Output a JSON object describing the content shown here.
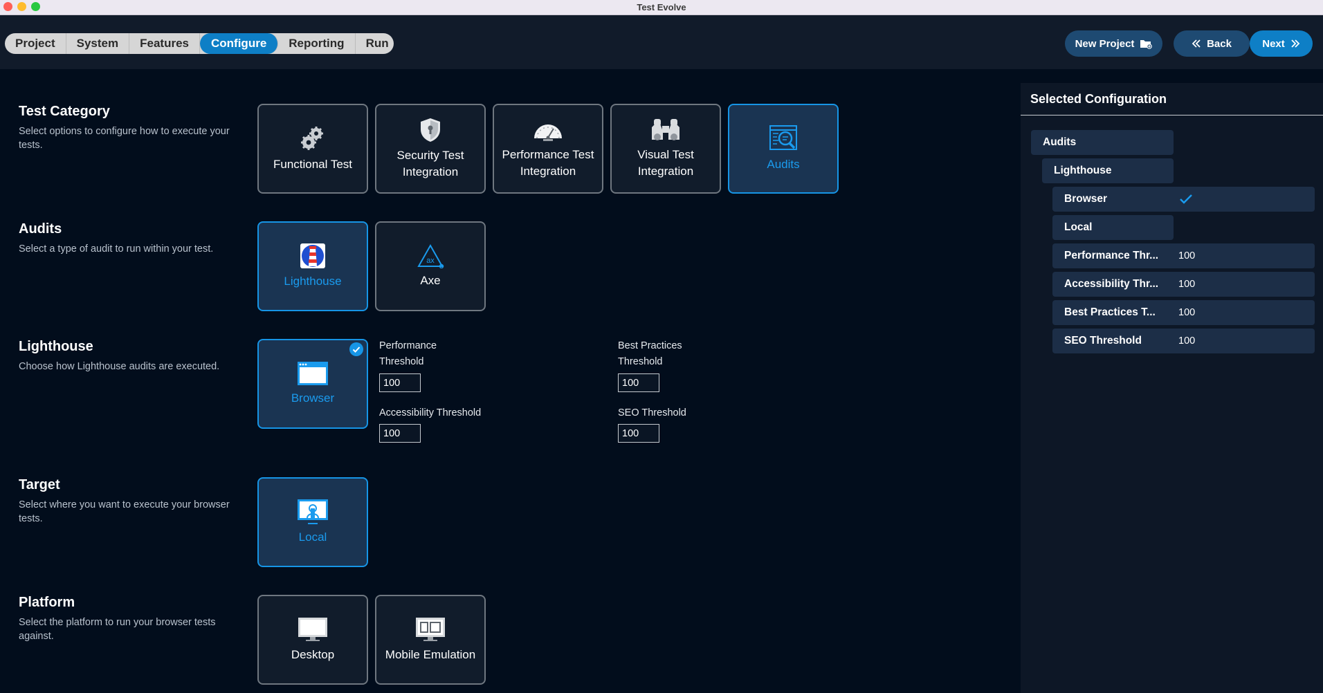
{
  "window": {
    "title": "Test Evolve"
  },
  "nav": {
    "tabs": [
      "Project",
      "System",
      "Features",
      "Configure",
      "Reporting",
      "Run"
    ],
    "active_tab": "Configure",
    "new_project_label": "New Project",
    "back_label": "Back",
    "next_label": "Next"
  },
  "sections": {
    "test_category": {
      "title": "Test Category",
      "desc": "Select options to configure how to execute your tests.",
      "options": [
        {
          "line1": "Functional Test",
          "line2": "",
          "icon": "gears-icon",
          "selected": false
        },
        {
          "line1": "Security Test",
          "line2": "Integration",
          "icon": "shield-icon",
          "selected": false
        },
        {
          "line1": "Performance Test",
          "line2": "Integration",
          "icon": "speedometer-icon",
          "selected": false
        },
        {
          "line1": "Visual Test",
          "line2": "Integration",
          "icon": "binoculars-icon",
          "selected": false
        },
        {
          "line1": "Audits",
          "line2": "",
          "icon": "audit-magnifier-icon",
          "selected": true
        }
      ]
    },
    "audits": {
      "title": "Audits",
      "desc": "Select a type of audit to run within your test.",
      "options": [
        {
          "label": "Lighthouse",
          "icon": "lighthouse-icon",
          "selected": true
        },
        {
          "label": "Axe",
          "icon": "axe-icon",
          "selected": false
        }
      ]
    },
    "lighthouse": {
      "title": "Lighthouse",
      "desc": "Choose how Lighthouse audits are executed.",
      "options": [
        {
          "label": "Browser",
          "icon": "browser-window-icon",
          "selected": true
        }
      ],
      "fields": {
        "performance": {
          "label_line1": "Performance",
          "label_line2": "Threshold",
          "value": "100"
        },
        "best_practices": {
          "label_line1": "Best Practices",
          "label_line2": "Threshold",
          "value": "100"
        },
        "accessibility": {
          "label": "Accessibility Threshold",
          "value": "100"
        },
        "seo": {
          "label": "SEO Threshold",
          "value": "100"
        }
      }
    },
    "target": {
      "title": "Target",
      "desc": "Select where you want to execute your browser tests.",
      "options": [
        {
          "label": "Local",
          "icon": "local-machine-icon",
          "selected": true
        }
      ]
    },
    "platform": {
      "title": "Platform",
      "desc": "Select the platform to run your browser tests against.",
      "options": [
        {
          "label": "Desktop",
          "icon": "desktop-monitor-icon",
          "selected": false
        },
        {
          "label": "Mobile Emulation",
          "icon": "mobile-emulation-icon",
          "selected": false
        }
      ]
    }
  },
  "selected_config": {
    "title": "Selected Configuration",
    "rows": [
      {
        "key": "Audits",
        "value": ""
      },
      {
        "key": "Lighthouse",
        "value": ""
      },
      {
        "key": "Browser",
        "value": "",
        "checked": true
      },
      {
        "key": "Local",
        "value": ""
      },
      {
        "key": "Performance Thr...",
        "value": "100"
      },
      {
        "key": "Accessibility Thr...",
        "value": "100"
      },
      {
        "key": "Best Practices T...",
        "value": "100"
      },
      {
        "key": "SEO Threshold",
        "value": "100"
      }
    ]
  },
  "colors": {
    "accent": "#0e7fc6",
    "selected_border": "#1695e6",
    "background": "#020d1c",
    "panel": "#0d1726"
  }
}
